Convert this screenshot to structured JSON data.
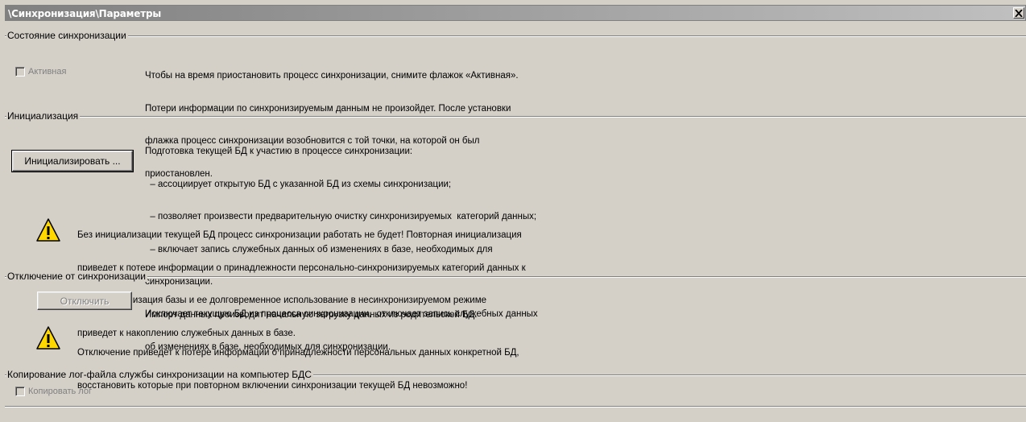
{
  "window": {
    "title": "\\Синхронизация\\Параметры",
    "close_icon": "close-icon"
  },
  "sync_state": {
    "legend": "Состояние синхронизации",
    "active_checkbox": {
      "label": "Активная",
      "checked": false,
      "enabled": false
    },
    "description": [
      "Чтобы на время приостановить процесс синхронизации, снимите флажок «Активная».",
      "Потери информации по синхронизируемым данным не произойдет. После установки",
      "флажка процесс синхронизации возобновится с той точки, на которой он был",
      "приостановлен."
    ]
  },
  "init": {
    "legend": "Инициализация",
    "button_label": "Инициализировать ...",
    "description": [
      "Подготовка текущей БД к участию в процессе синхронизации:",
      "  – ассоциирует открытую БД с указанной БД из схемы синхронизации;",
      "  – позволяет произвести предварительную очистку синхронизируемых  категорий данных;",
      "  – включает запись служебных данных об изменениях в базе, необходимых для",
      "синхронизации.",
      "Импорт данных производит начальную загрузку данных из родительской БД."
    ],
    "warning": [
      "Без инициализации текущей БД процесс синхронизации работать не будет! Повторная инициализация",
      "приведет к потере информации о принадлежности персонально-синхронизируемых категорий данных к",
      "БД. Инициализация базы и ее долговременное использование в несинхронизируемом режиме",
      "приведет к накоплению служебных данных в базе."
    ],
    "warning_icon": "warning-icon"
  },
  "disconnect": {
    "legend": "Отключение от синхронизации",
    "button_label": "Отключить",
    "description": [
      "Исключает текущую БД из процесса синхронизации,  отключает запись служебных данных",
      "об изменениях в базе, необходимых для синхронизации."
    ],
    "warning": [
      "Отключение приведет к потере информации о принадлежности персональных данных конкретной БД,",
      "восстановить которые при повторном включении синхронизации текущей БД невозможно!"
    ],
    "warning_icon": "warning-icon"
  },
  "copy_log": {
    "legend": "Копирование лог-файла службы синхронизации на компьютер БДС",
    "checkbox": {
      "label": "Копировать лог",
      "checked": false,
      "enabled": false
    }
  }
}
